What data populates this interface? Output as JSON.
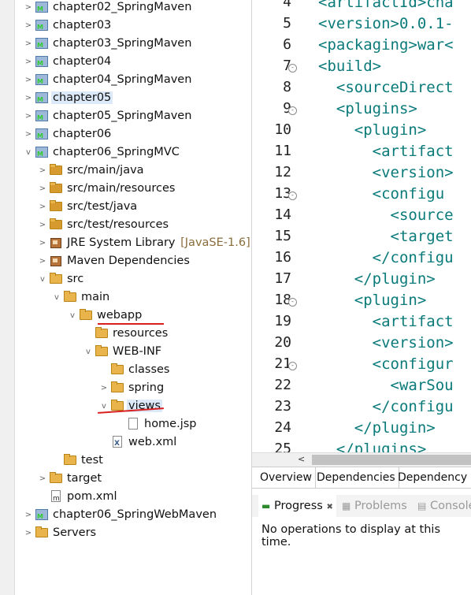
{
  "explorer": {
    "items": [
      {
        "label": "chapter02_SpringMaven",
        "icon": "project-icon"
      },
      {
        "label": "chapter03",
        "icon": "project-icon"
      },
      {
        "label": "chapter03_SpringMaven",
        "icon": "project-icon"
      },
      {
        "label": "chapter04",
        "icon": "project-icon"
      },
      {
        "label": "chapter04_SpringMaven",
        "icon": "project-icon"
      },
      {
        "label": "chapter05",
        "icon": "project-icon"
      },
      {
        "label": "chapter05_SpringMaven",
        "icon": "project-icon"
      },
      {
        "label": "chapter06",
        "icon": "project-icon"
      },
      {
        "label": "chapter06_SpringMVC",
        "icon": "project-icon"
      },
      {
        "label": "src/main/java",
        "icon": "source-folder-icon"
      },
      {
        "label": "src/main/resources",
        "icon": "source-folder-icon"
      },
      {
        "label": "src/test/java",
        "icon": "source-folder-icon"
      },
      {
        "label": "src/test/resources",
        "icon": "source-folder-icon"
      },
      {
        "label": "JRE System Library",
        "decoration": "[JavaSE-1.6]",
        "icon": "library-icon"
      },
      {
        "label": "Maven Dependencies",
        "icon": "library-icon"
      },
      {
        "label": "src",
        "icon": "folder-icon"
      },
      {
        "label": "main",
        "icon": "folder-icon"
      },
      {
        "label": "webapp",
        "icon": "folder-icon"
      },
      {
        "label": "resources",
        "icon": "folder-icon"
      },
      {
        "label": "WEB-INF",
        "icon": "folder-icon"
      },
      {
        "label": "classes",
        "icon": "folder-icon"
      },
      {
        "label": "spring",
        "icon": "folder-icon"
      },
      {
        "label": "views",
        "icon": "folder-icon"
      },
      {
        "label": "home.jsp",
        "icon": "jsp-file-icon"
      },
      {
        "label": "web.xml",
        "icon": "xml-file-icon"
      },
      {
        "label": "test",
        "icon": "folder-icon"
      },
      {
        "label": "target",
        "icon": "folder-icon"
      },
      {
        "label": "pom.xml",
        "icon": "pom-file-icon"
      },
      {
        "label": "chapter06_SpringWebMaven",
        "icon": "project-icon"
      },
      {
        "label": "Servers",
        "icon": "folder-icon"
      }
    ]
  },
  "editor": {
    "lines": [
      {
        "num": "4",
        "code": "<artifactId>cha"
      },
      {
        "num": "5",
        "code": "<version>0.0.1-"
      },
      {
        "num": "6",
        "code": "<packaging>war<"
      },
      {
        "num": "7",
        "code": "<build>"
      },
      {
        "num": "8",
        "code": "  <sourceDirect"
      },
      {
        "num": "9",
        "code": "  <plugins>"
      },
      {
        "num": "10",
        "code": "    <plugin>"
      },
      {
        "num": "11",
        "code": "      <artifact"
      },
      {
        "num": "12",
        "code": "      <version>"
      },
      {
        "num": "13",
        "code": "      <configu"
      },
      {
        "num": "14",
        "code": "        <source"
      },
      {
        "num": "15",
        "code": "        <target"
      },
      {
        "num": "16",
        "code": "      </configu"
      },
      {
        "num": "17",
        "code": "    </plugin>"
      },
      {
        "num": "18",
        "code": "    <plugin>"
      },
      {
        "num": "19",
        "code": "      <artifact"
      },
      {
        "num": "20",
        "code": "      <version>"
      },
      {
        "num": "21",
        "code": "      <configur"
      },
      {
        "num": "22",
        "code": "        <warSou"
      },
      {
        "num": "23",
        "code": "      </configu"
      },
      {
        "num": "24",
        "code": "    </plugin>"
      },
      {
        "num": "25",
        "code": "  </plugins>"
      }
    ],
    "tabs": [
      "Overview",
      "Dependencies",
      "Dependency H"
    ]
  },
  "progress": {
    "tab_progress": "Progress",
    "tab_close": "✖",
    "tab_problems": "Problems",
    "tab_console": "Console",
    "message": "No operations to display at this time."
  }
}
